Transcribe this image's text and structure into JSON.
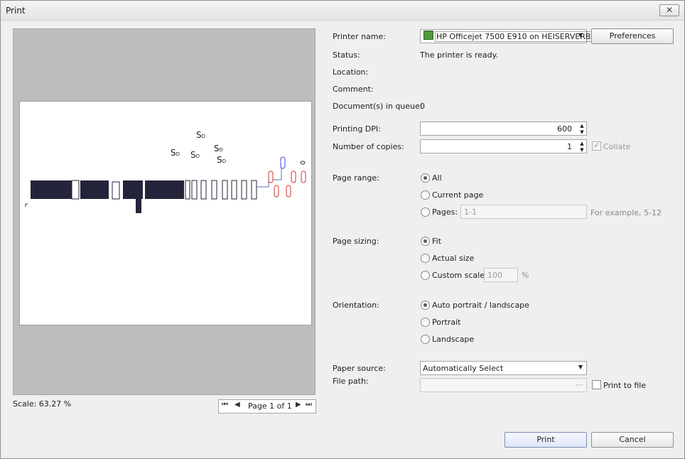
{
  "window": {
    "title": "Print",
    "close_icon": "✕"
  },
  "preview": {
    "scale": "Scale: 63.27 %",
    "pager": {
      "label": "Page 1 of 1",
      "first": "⏮",
      "prev": "◀",
      "next": "▶",
      "last": "⏭"
    }
  },
  "printer": {
    "name_label": "Printer name:",
    "name_value": "HP Officejet 7500 E910 on HEISERVERB",
    "preferences": "Preferences",
    "status_label": "Status:",
    "status_value": "The printer is ready.",
    "location_label": "Location:",
    "location_value": "",
    "comment_label": "Comment:",
    "comment_value": "",
    "queue_label": "Document(s) in queue:",
    "queue_value": "0"
  },
  "options": {
    "dpi_label": "Printing DPI:",
    "dpi_value": "600",
    "copies_label": "Number of copies:",
    "copies_value": "1",
    "collate": "Collate",
    "page_range_label": "Page range:",
    "range_all": "All",
    "range_current": "Current page",
    "range_pages": "Pages:",
    "pages_value": "1-1",
    "pages_hint": "For example, 5-12",
    "page_sizing_label": "Page sizing:",
    "size_fit": "Fit",
    "size_actual": "Actual size",
    "size_custom": "Custom scale:",
    "custom_value": "100",
    "custom_unit": "%",
    "orientation_label": "Orientation:",
    "orient_auto": "Auto portrait / landscape",
    "orient_portrait": "Portrait",
    "orient_landscape": "Landscape",
    "paper_source_label": "Paper source:",
    "paper_source_value": "Automatically Select",
    "file_path_label": "File path:",
    "file_path_ellipsis": "⋯",
    "print_to_file": "Print to file"
  },
  "actions": {
    "print": "Print",
    "cancel": "Cancel"
  },
  "preview_marks": {
    "s_label": "S",
    "d_label": "D"
  },
  "colors": {
    "accent": "#5b6aa8",
    "dark_bar": "#23233a"
  }
}
